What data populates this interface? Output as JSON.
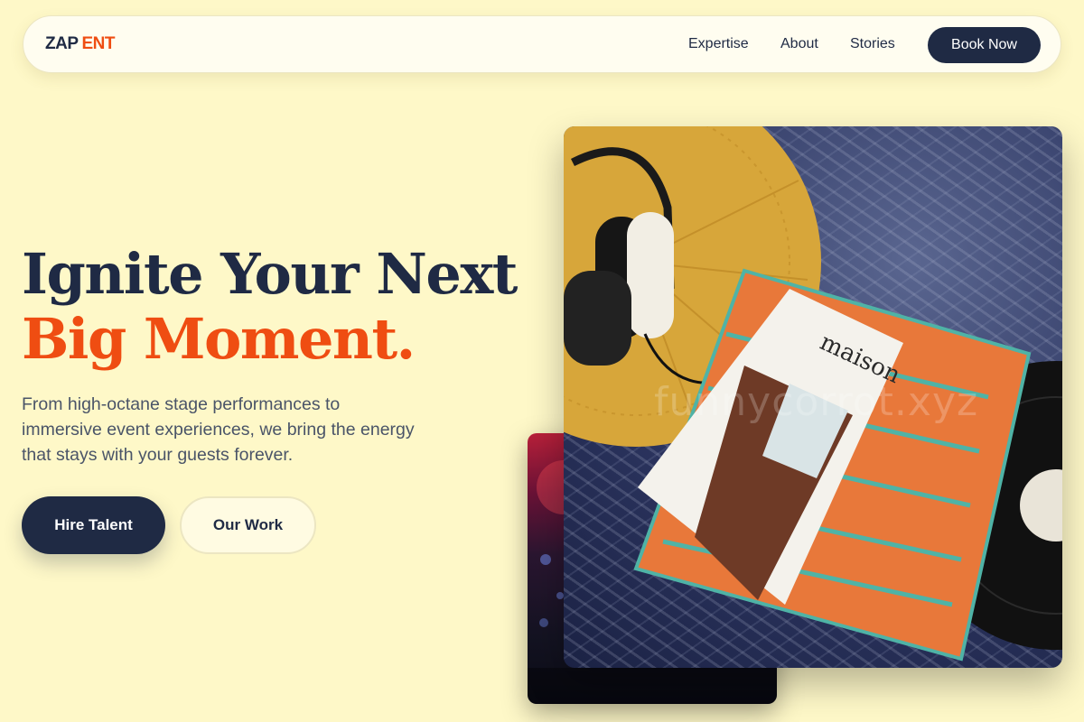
{
  "nav": {
    "logo_part1": "ZAP",
    "logo_part2": "ENT",
    "links": [
      "Expertise",
      "About",
      "Stories"
    ],
    "cta": "Book Now"
  },
  "hero": {
    "headline_line1": "Ignite Your Next",
    "headline_line2": "Big Moment.",
    "subtext": "From high-octane stage performances to immersive event experiences, we bring the energy that stays with your guests forever.",
    "primary_button": "Hire Talent",
    "secondary_button": "Our Work"
  },
  "photo": {
    "magazine_title": "maison",
    "watermark": "funnycorrot.xyz"
  },
  "colors": {
    "background": "#fef8c8",
    "navy": "#1f2a44",
    "accent": "#ef4d12"
  }
}
